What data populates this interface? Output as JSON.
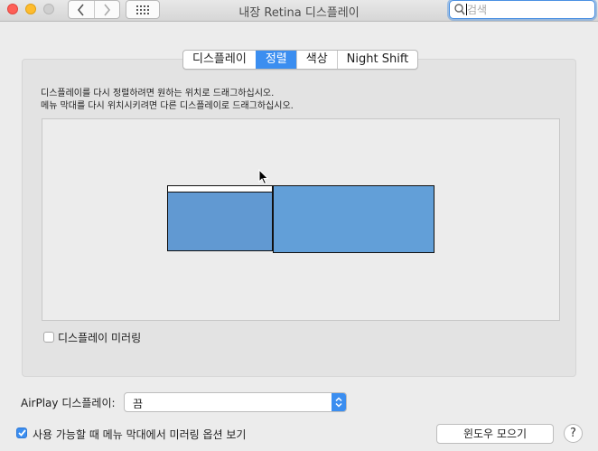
{
  "window": {
    "title": "내장 Retina 디스플레이"
  },
  "search": {
    "placeholder": "검색",
    "value": ""
  },
  "tabs": [
    {
      "label": "디스플레이",
      "active": false
    },
    {
      "label": "정렬",
      "active": true
    },
    {
      "label": "색상",
      "active": false
    },
    {
      "label": "Night Shift",
      "active": false
    }
  ],
  "arrangement": {
    "instruction_line1": "디스플레이를 다시 정렬하려면 원하는 위치로 드래그하십시오.",
    "instruction_line2": "메뉴 막대를 다시 위치시키려면 다른 디스플레이로 드래그하십시오."
  },
  "mirroring": {
    "label": "디스플레이 미러링",
    "checked": false
  },
  "airplay": {
    "label": "AirPlay 디스플레이:",
    "selected": "끔"
  },
  "show_in_menubar": {
    "label": "사용 가능할 때 메뉴 막대에서 미러링 옵션 보기",
    "checked": true
  },
  "gather_windows_button": "윈도우 모으기",
  "help_button": "?",
  "colors": {
    "accent": "#3b8ef0",
    "display_fill": "#6199d2"
  },
  "icons": {
    "back": "chevron-left-icon",
    "forward": "chevron-right-icon",
    "grid": "grid-icon",
    "search": "magnifier-icon"
  }
}
